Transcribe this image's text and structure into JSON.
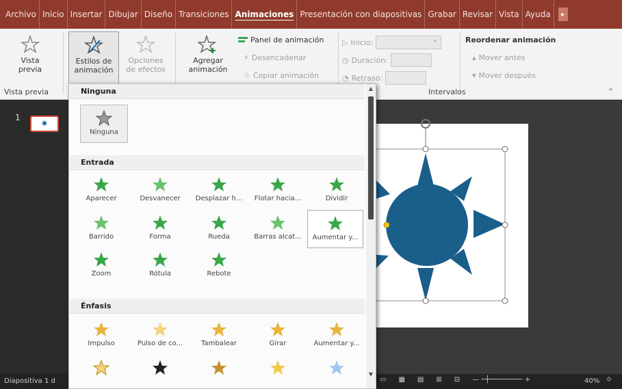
{
  "menubar": {
    "items": [
      "Archivo",
      "Inicio",
      "Insertar",
      "Dibujar",
      "Diseño",
      "Transiciones",
      "Animaciones",
      "Presentación con diapositivas",
      "Grabar",
      "Revisar",
      "Vista",
      "Ayuda"
    ],
    "active": "Animaciones"
  },
  "ribbon": {
    "vista_previa": "Vista previa",
    "vista_previa_arrow": "⌄",
    "estilos": "Estilos de animación",
    "opciones": "Opciones de efectos",
    "agregar": "Agregar animación",
    "panel": "Panel de animación",
    "desencadenar": "Desencadenar",
    "copiar": "Copiar animación",
    "inicio": "Inicio:",
    "duracion": "Duración:",
    "retraso": "Retraso:",
    "reordenar": "Reordenar animación",
    "mover_antes": "Mover antes",
    "mover_despues": "Mover después",
    "grp_vista_previa": "Vista previa",
    "grp_intervalos": "Intervalos"
  },
  "slidepane": {
    "slide_number": "1"
  },
  "status": {
    "slide": "Diapositiva 1 d",
    "zoom": "40%"
  },
  "gallery": {
    "sections": {
      "ninguna": "Ninguna",
      "entrada": "Entrada",
      "enfasis": "Énfasis"
    },
    "ninguna_tile": "Ninguna",
    "entrada": [
      "Aparecer",
      "Desvanecer",
      "Desplazar h...",
      "Flotar hacia...",
      "Dividir",
      "Barrido",
      "Forma",
      "Rueda",
      "Barras alcat...",
      "Aumentar y...",
      "Zoom",
      "Rótula",
      "Rebote"
    ],
    "enfasis": [
      "Impulso",
      "Pulso de co...",
      "Tambalear",
      "Girar",
      "Aumentar y..."
    ]
  },
  "colors": {
    "accent": "#8f3a2c",
    "green_star": "#3aa64a",
    "gold_star": "#e8b53a",
    "shape": "#1a5e8a"
  },
  "icons": [
    "star-icon",
    "brush-star-icon",
    "add-star-icon",
    "panel-icon",
    "slide-star-icon"
  ]
}
